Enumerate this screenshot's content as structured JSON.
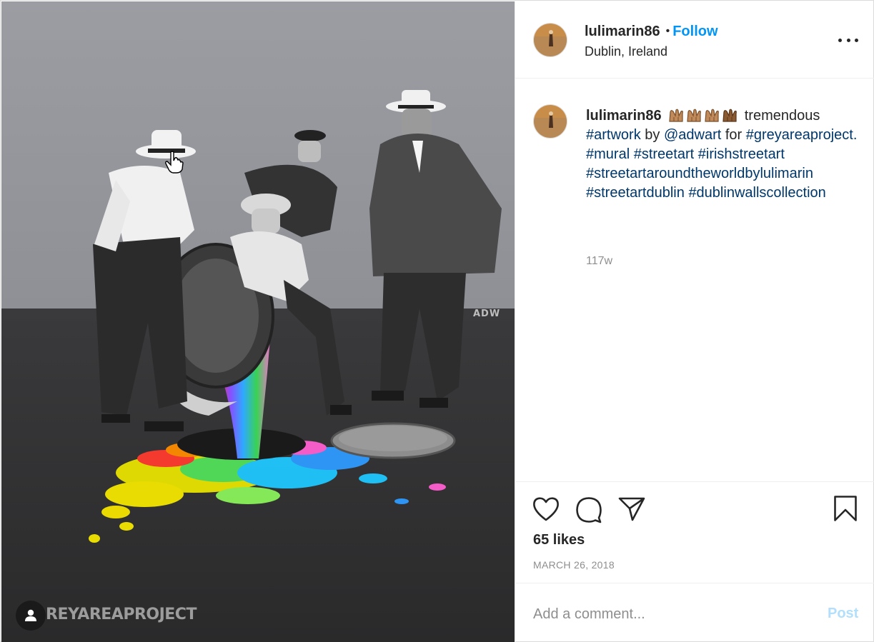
{
  "post": {
    "username": "lulimarin86",
    "follow_label": "Follow",
    "location": "Dublin, Ireland",
    "image_wall_text": "REYAREAPROJECT",
    "image_artist_tag": "ADW"
  },
  "caption": {
    "username": "lulimarin86",
    "emoji_name": "raised-hands-emoji",
    "emoji_count": 4,
    "text_1": "tremendous",
    "tag_artwork": "#artwork",
    "text_by": "by",
    "mention": "@adwart",
    "text_for": "for",
    "tag_greyareaproject": "#greyareaproject.",
    "tag_mural": "#mural",
    "tag_streetart": "#streetart",
    "tag_irishstreetart": "#irishstreetart",
    "tag_streetartaroundtheworld": "#streetartaroundtheworldbylulimarin",
    "tag_streetartdublin": "#streetartdublin",
    "tag_dublinwalls": "#dublinwallscollection",
    "age": "117w"
  },
  "actions": {
    "like_icon": "heart-icon",
    "comment_icon": "comment-icon",
    "share_icon": "paper-plane-icon",
    "save_icon": "bookmark-icon",
    "likes": "65 likes",
    "date": "MARCH 26, 2018"
  },
  "comment": {
    "placeholder": "Add a comment...",
    "post_label": "Post"
  },
  "colors": {
    "follow": "#0095f6",
    "hashtag": "#00376b",
    "muted": "#8e8e8e",
    "post_disabled": "#b2dffc"
  }
}
